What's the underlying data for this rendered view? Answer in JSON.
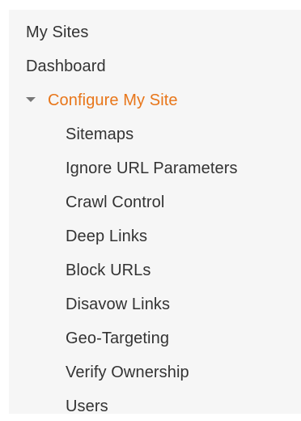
{
  "nav": {
    "my_sites": "My Sites",
    "dashboard": "Dashboard",
    "configure": {
      "label": "Configure My Site",
      "icon": "triangle-down-icon",
      "accent_color": "#e8761a",
      "items": [
        "Sitemaps",
        "Ignore URL Parameters",
        "Crawl Control",
        "Deep Links",
        "Block URLs",
        "Disavow Links",
        "Geo-Targeting",
        "Verify Ownership",
        "Users"
      ]
    }
  }
}
